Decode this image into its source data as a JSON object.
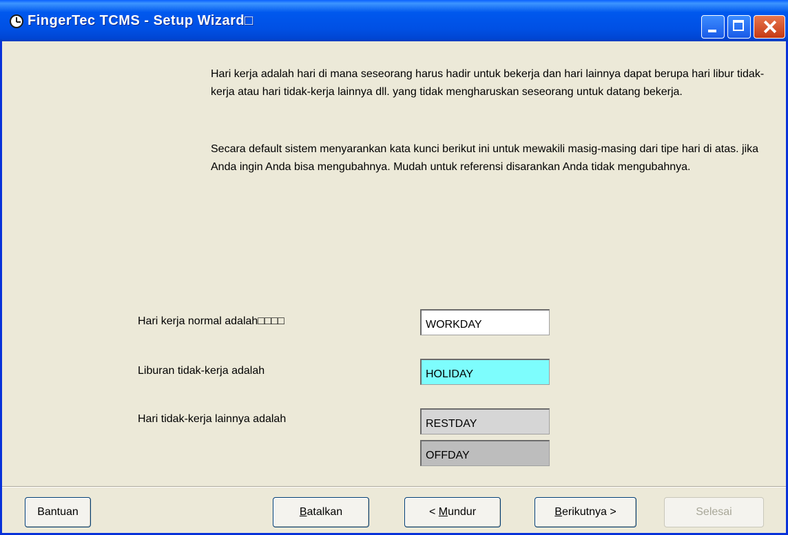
{
  "window": {
    "title": "FingerTec TCMS - Setup Wizard□",
    "accent": "#0054e3"
  },
  "description": {
    "paragraph1": "Hari kerja adalah hari di mana seseorang harus hadir untuk bekerja dan hari lainnya dapat berupa hari libur tidak-kerja atau hari tidak-kerja lainnya dll. yang tidak mengharuskan seseorang untuk datang bekerja.",
    "paragraph2": "Secara default sistem menyarankan kata kunci berikut ini untuk mewakili masig-masing dari tipe hari di atas. jika Anda ingin Anda bisa mengubahnya. Mudah untuk referensi disarankan Anda tidak mengubahnya."
  },
  "fields": {
    "workday": {
      "label": "Hari kerja normal adalah□□□□",
      "value": "WORKDAY",
      "bg": "#ffffff"
    },
    "holiday": {
      "label": "Liburan tidak-kerja adalah",
      "value": "HOLIDAY",
      "bg": "#7dfdfd"
    },
    "other": {
      "label": "Hari tidak-kerja lainnya adalah",
      "restday": "RESTDAY",
      "offday": "OFFDAY",
      "restday_bg": "#d6d6d6",
      "offday_bg": "#bdbdbd"
    }
  },
  "buttons": {
    "help": {
      "label": "Bantuan"
    },
    "cancel": {
      "mnemonic": "B",
      "rest": "atalkan"
    },
    "back": {
      "prefix": "< ",
      "mnemonic": "M",
      "rest": "undur"
    },
    "next": {
      "mnemonic": "B",
      "rest": "erikutnya >"
    },
    "finish": {
      "label": "Selesai",
      "enabled": false
    }
  }
}
